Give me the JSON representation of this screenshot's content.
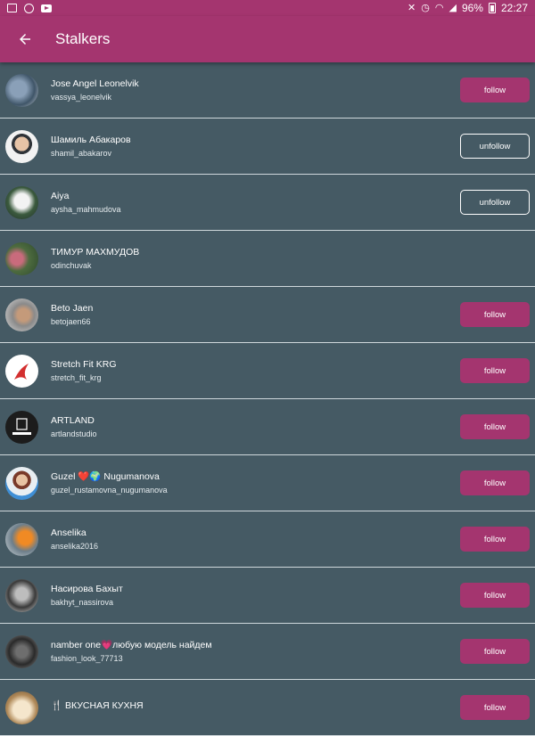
{
  "status_bar": {
    "battery": "96%",
    "time": "22:27"
  },
  "app_bar": {
    "title": "Stalkers"
  },
  "theme": {
    "accent": "#a4356f",
    "background": "#455a64",
    "divider": "#cfd8dc"
  },
  "rows": [
    {
      "name": "Jose Angel Leonelvik",
      "username": "vassya_leonelvik",
      "action": "follow"
    },
    {
      "name": "Шамиль Абакаров",
      "username": "shamil_abakarov",
      "action": "unfollow"
    },
    {
      "name": "Aiya",
      "username": "aysha_mahmudova",
      "action": "unfollow"
    },
    {
      "name": "ТИМУР МАХМУДОВ",
      "username": "odinchuvak",
      "action": ""
    },
    {
      "name": "Beto Jaen",
      "username": "betojaen66",
      "action": "follow"
    },
    {
      "name": "Stretch Fit KRG",
      "username": "stretch_fit_krg",
      "action": "follow"
    },
    {
      "name": "ARTLAND",
      "username": "artlandstudio",
      "action": "follow"
    },
    {
      "name": "Guzel ❤️🌍 Nugumanova",
      "username": "guzel_rustamovna_nugumanova",
      "action": "follow"
    },
    {
      "name": "Anselika",
      "username": "anselika2016",
      "action": "follow"
    },
    {
      "name": "Насирова Бахыт",
      "username": "bakhyt_nassirova",
      "action": "follow"
    },
    {
      "name": "namber one💗любую модель найдем",
      "username": "fashion_look_77713",
      "action": "follow"
    },
    {
      "name": "🍴 ВКУСНАЯ КУХНЯ",
      "username": "",
      "action": "follow"
    }
  ]
}
